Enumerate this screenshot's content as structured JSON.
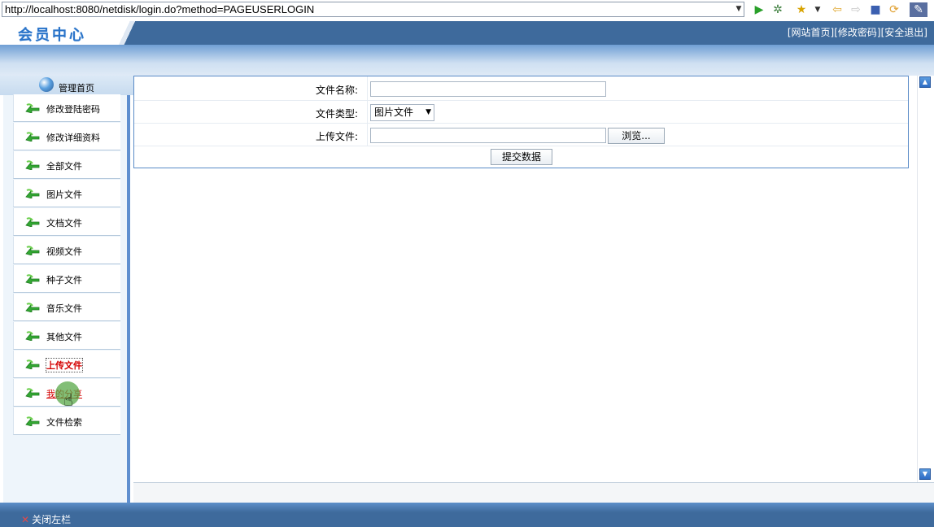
{
  "browser": {
    "url": "http://localhost:8080/netdisk/login.do?method=PAGEUSERLOGIN",
    "toolbar_icons": [
      "go-icon",
      "debug-icon",
      "favorites-icon",
      "back-icon",
      "forward-icon",
      "stop-icon",
      "refresh-icon",
      "eclipse-icon"
    ]
  },
  "header": {
    "logo_text": "会员中心",
    "links": [
      "[网站首页]",
      "[修改密码]",
      "[安全退出]"
    ]
  },
  "sidebar": {
    "home_label": "管理首页",
    "items": [
      {
        "label": "修改登陆密码"
      },
      {
        "label": "修改详细资料"
      },
      {
        "label": "全部文件"
      },
      {
        "label": "图片文件"
      },
      {
        "label": "文档文件"
      },
      {
        "label": "视频文件"
      },
      {
        "label": "种子文件"
      },
      {
        "label": "音乐文件"
      },
      {
        "label": "其他文件"
      },
      {
        "label": "上传文件"
      },
      {
        "label": "我的分享"
      },
      {
        "label": "文件检索"
      }
    ]
  },
  "form": {
    "name_label": "文件名称:",
    "name_value": "",
    "type_label": "文件类型:",
    "type_selected": "图片文件",
    "upload_label": "上传文件:",
    "upload_value": "",
    "browse_label": "浏览...",
    "submit_label": "提交数据"
  },
  "footer": {
    "close_label": "关闭左栏"
  },
  "colors": {
    "header_bg": "#3e6a9c",
    "sidebar_bg": "#eef5fb",
    "active_link": "#d30000",
    "logo_text": "#2b74c9"
  }
}
